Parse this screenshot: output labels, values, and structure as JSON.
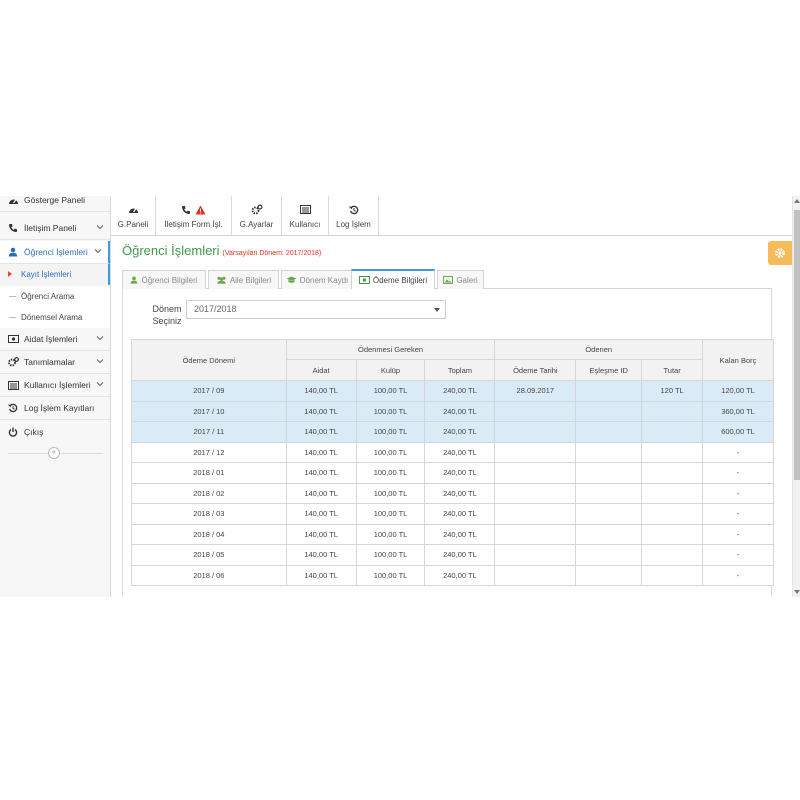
{
  "sidebar": {
    "items": [
      {
        "label": "Gösterge Paneli",
        "icon": "dashboard-icon"
      },
      {
        "label": "İletişim Paneli",
        "icon": "phone-icon"
      },
      {
        "label": "Öğrenci İşlemleri",
        "icon": "user-icon"
      },
      {
        "label": "Aidat İşlemleri",
        "icon": "money-icon"
      },
      {
        "label": "Tanımlamalar",
        "icon": "cogs-icon"
      },
      {
        "label": "Kullanıcı İşlemleri",
        "icon": "list-icon"
      },
      {
        "label": "Log İşlem Kayıtları",
        "icon": "history-icon"
      },
      {
        "label": "Çıkış",
        "icon": "power-icon"
      }
    ],
    "sub_items": [
      {
        "label": "Kayıt İşlemleri"
      },
      {
        "label": "Öğrenci Arama"
      },
      {
        "label": "Dönemsel Arama"
      }
    ],
    "collapse_label": "«"
  },
  "toolbar": {
    "buttons": [
      {
        "label": "G.Paneli",
        "icon": "dashboard-icon"
      },
      {
        "label": "İletişim Form İşl.",
        "icon": "phone-warning-icon"
      },
      {
        "label": "G.Ayarlar",
        "icon": "cogs-icon"
      },
      {
        "label": "Kullanıcı",
        "icon": "list-icon"
      },
      {
        "label": "Log İşlem",
        "icon": "history-icon"
      }
    ]
  },
  "page": {
    "title": "Öğrenci İşlemleri",
    "subtitle": "(Varsayılan Dönem: 2017/2018)",
    "accent_green": "#3f9a48",
    "accent_red": "#e0321c",
    "gear_color": "#f6bb58"
  },
  "tabs": [
    {
      "label": "Öğrenci Bilgileri",
      "icon": "user-icon",
      "active": false
    },
    {
      "label": "Aile Bilgileri",
      "icon": "users-icon",
      "active": false
    },
    {
      "label": "Dönem Kaydı",
      "icon": "graduation-cap-icon",
      "active": false
    },
    {
      "label": "Ödeme Bilgileri",
      "icon": "money-icon",
      "active": true
    },
    {
      "label": "Galeri",
      "icon": "image-icon",
      "active": false
    }
  ],
  "form": {
    "donem_label_1": "Dönem",
    "donem_label_2": "Seçiniz",
    "donem_value": "2017/2018"
  },
  "table": {
    "headers": {
      "period": "Ödeme Dönemi",
      "group_due": "Ödenmesi Gereken",
      "group_paid": "Ödenen",
      "balance": "Kalan Borç",
      "aidat": "Aidat",
      "kulup": "Kulüp",
      "toplam": "Toplam",
      "odeme_tarihi": "Ödeme Tarihi",
      "eslesme_id": "Eşleşme ID",
      "tutar": "Tutar"
    },
    "highlight_color": "#d9ebf6",
    "rows": [
      {
        "period": "2017 / 09",
        "aidat": "140,00 TL",
        "kulup": "100,00 TL",
        "toplam": "240,00 TL",
        "tarih": "28.09.2017",
        "eslesme": "",
        "tutar": "120 TL",
        "kalan": "120,00 TL",
        "highlight": true
      },
      {
        "period": "2017 / 10",
        "aidat": "140,00 TL",
        "kulup": "100,00 TL",
        "toplam": "240,00 TL",
        "tarih": "",
        "eslesme": "",
        "tutar": "",
        "kalan": "360,00 TL",
        "highlight": true
      },
      {
        "period": "2017 / 11",
        "aidat": "140,00 TL",
        "kulup": "100,00 TL",
        "toplam": "240,00 TL",
        "tarih": "",
        "eslesme": "",
        "tutar": "",
        "kalan": "600,00 TL",
        "highlight": true
      },
      {
        "period": "2017 / 12",
        "aidat": "140,00 TL",
        "kulup": "100,00 TL",
        "toplam": "240,00 TL",
        "tarih": "",
        "eslesme": "",
        "tutar": "",
        "kalan": "-",
        "highlight": false
      },
      {
        "period": "2018 / 01",
        "aidat": "140,00 TL",
        "kulup": "100,00 TL",
        "toplam": "240,00 TL",
        "tarih": "",
        "eslesme": "",
        "tutar": "",
        "kalan": "-",
        "highlight": false
      },
      {
        "period": "2018 / 02",
        "aidat": "140,00 TL",
        "kulup": "100,00 TL",
        "toplam": "240,00 TL",
        "tarih": "",
        "eslesme": "",
        "tutar": "",
        "kalan": "-",
        "highlight": false
      },
      {
        "period": "2018 / 03",
        "aidat": "140,00 TL",
        "kulup": "100,00 TL",
        "toplam": "240,00 TL",
        "tarih": "",
        "eslesme": "",
        "tutar": "",
        "kalan": "-",
        "highlight": false
      },
      {
        "period": "2018 / 04",
        "aidat": "140,00 TL",
        "kulup": "100,00 TL",
        "toplam": "240,00 TL",
        "tarih": "",
        "eslesme": "",
        "tutar": "",
        "kalan": "-",
        "highlight": false
      },
      {
        "period": "2018 / 05",
        "aidat": "140,00 TL",
        "kulup": "100,00 TL",
        "toplam": "240,00 TL",
        "tarih": "",
        "eslesme": "",
        "tutar": "",
        "kalan": "-",
        "highlight": false
      },
      {
        "period": "2018 / 06",
        "aidat": "140,00 TL",
        "kulup": "100,00 TL",
        "toplam": "240,00 TL",
        "tarih": "",
        "eslesme": "",
        "tutar": "",
        "kalan": "-",
        "highlight": false
      }
    ]
  }
}
